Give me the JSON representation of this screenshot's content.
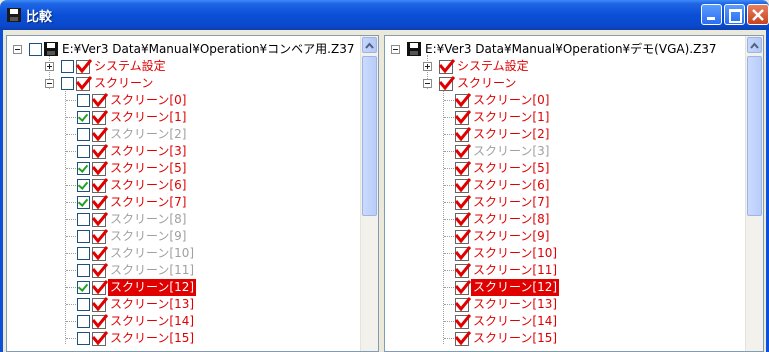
{
  "window": {
    "title": "比較",
    "minimize_label": "_",
    "maximize_label": "□",
    "close_label": "×"
  },
  "left": {
    "root": "E:¥Ver3 Data¥Manual¥Operation¥コンベア用.Z37",
    "system": "システム設定",
    "screen_group": "スクリーン",
    "items": [
      {
        "label": "スクリーン[0]",
        "checked": false,
        "style": "red"
      },
      {
        "label": "スクリーン[1]",
        "checked": true,
        "style": "red"
      },
      {
        "label": "スクリーン[2]",
        "checked": false,
        "style": "gray"
      },
      {
        "label": "スクリーン[3]",
        "checked": false,
        "style": "red"
      },
      {
        "label": "スクリーン[5]",
        "checked": true,
        "style": "red"
      },
      {
        "label": "スクリーン[6]",
        "checked": true,
        "style": "red"
      },
      {
        "label": "スクリーン[7]",
        "checked": true,
        "style": "red"
      },
      {
        "label": "スクリーン[8]",
        "checked": false,
        "style": "gray"
      },
      {
        "label": "スクリーン[9]",
        "checked": false,
        "style": "gray"
      },
      {
        "label": "スクリーン[10]",
        "checked": false,
        "style": "gray"
      },
      {
        "label": "スクリーン[11]",
        "checked": false,
        "style": "gray"
      },
      {
        "label": "スクリーン[12]",
        "checked": true,
        "style": "sel"
      },
      {
        "label": "スクリーン[13]",
        "checked": false,
        "style": "red"
      },
      {
        "label": "スクリーン[14]",
        "checked": false,
        "style": "red"
      },
      {
        "label": "スクリーン[15]",
        "checked": false,
        "style": "red"
      }
    ]
  },
  "right": {
    "root": "E:¥Ver3 Data¥Manual¥Operation¥デモ(VGA).Z37",
    "system": "システム設定",
    "screen_group": "スクリーン",
    "items": [
      {
        "label": "スクリーン[0]",
        "style": "red"
      },
      {
        "label": "スクリーン[1]",
        "style": "red"
      },
      {
        "label": "スクリーン[2]",
        "style": "red"
      },
      {
        "label": "スクリーン[3]",
        "style": "gray"
      },
      {
        "label": "スクリーン[5]",
        "style": "red"
      },
      {
        "label": "スクリーン[6]",
        "style": "red"
      },
      {
        "label": "スクリーン[7]",
        "style": "red"
      },
      {
        "label": "スクリーン[8]",
        "style": "red"
      },
      {
        "label": "スクリーン[9]",
        "style": "red"
      },
      {
        "label": "スクリーン[10]",
        "style": "red"
      },
      {
        "label": "スクリーン[11]",
        "style": "red"
      },
      {
        "label": "スクリーン[12]",
        "style": "sel"
      },
      {
        "label": "スクリーン[13]",
        "style": "red"
      },
      {
        "label": "スクリーン[14]",
        "style": "red"
      },
      {
        "label": "スクリーン[15]",
        "style": "red"
      }
    ]
  },
  "colors": {
    "diff_red": "#e00000",
    "same_gray": "#a0a0a0",
    "check_green": "#21a121",
    "title_blue": "#0a4fd6"
  },
  "icons": {
    "window": "disk-icon",
    "file": "disk-icon",
    "diff": "red-check-mark-icon"
  }
}
